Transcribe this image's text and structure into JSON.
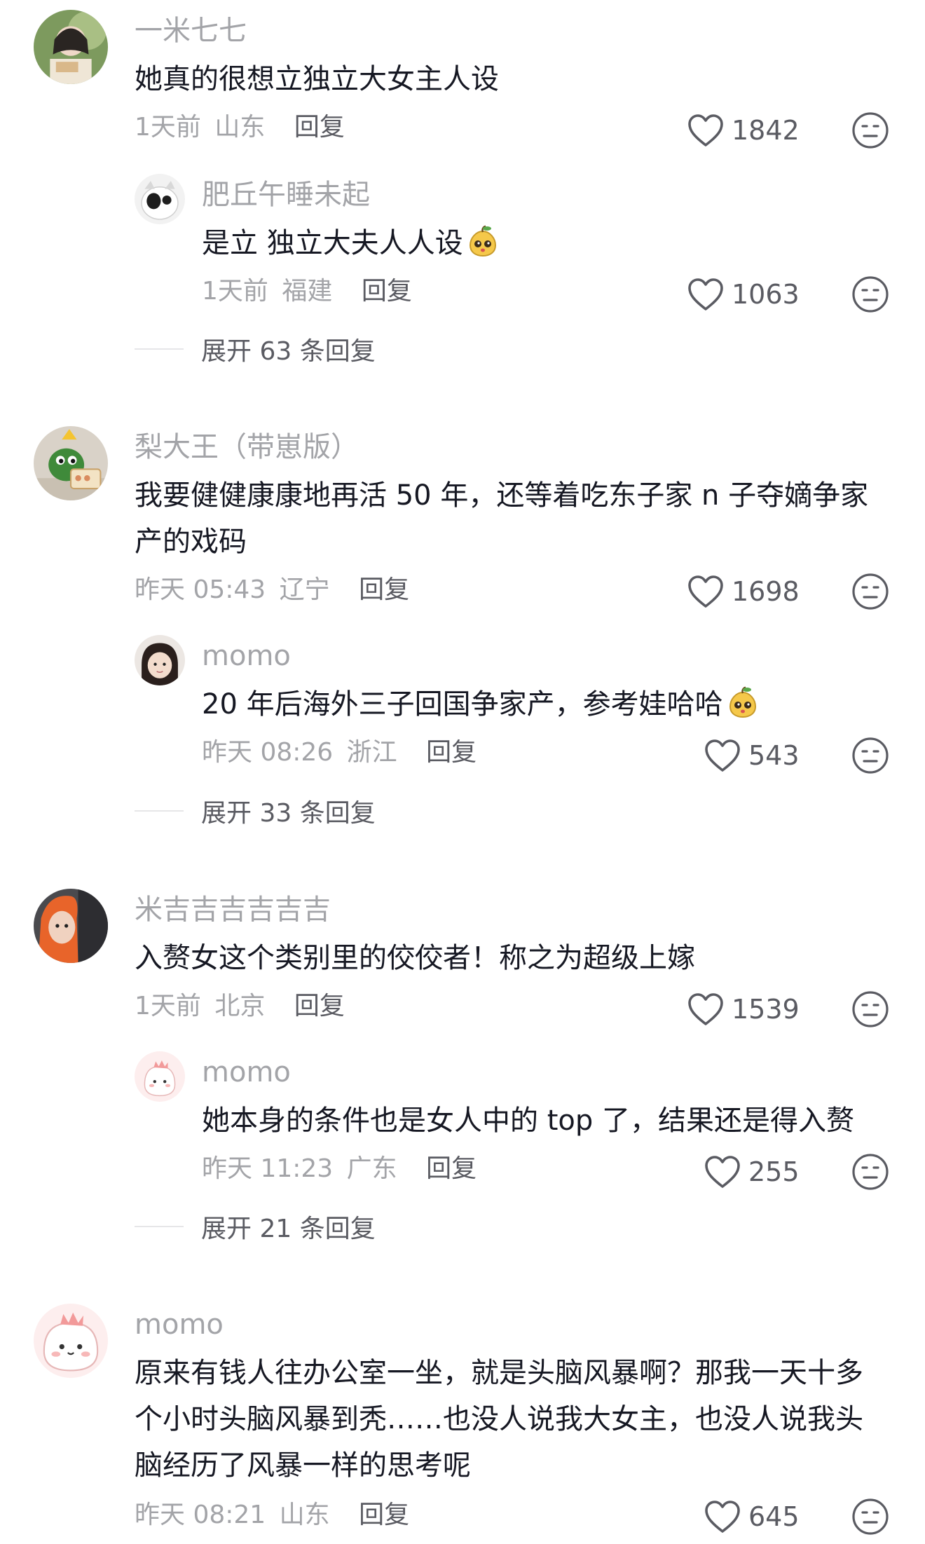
{
  "comments": [
    {
      "user": "一米七七",
      "text": "她真的很想立独立大女主人设",
      "time": "1天前",
      "location": "山东",
      "reply_label": "回复",
      "likes": "1842",
      "replies": [
        {
          "user": "肥丘午睡未起",
          "text": "是立 独立大夫人人设",
          "emoji": "pear-face-emoji",
          "time": "1天前",
          "location": "福建",
          "reply_label": "回复",
          "likes": "1063"
        }
      ],
      "expand_label": "展开 63 条回复"
    },
    {
      "user": "梨大王（带崽版）",
      "text": "我要健健康康地再活 50 年，还等着吃东子家 n 子夺嫡争家产的戏码",
      "time": "昨天 05:43",
      "location": "辽宁",
      "reply_label": "回复",
      "likes": "1698",
      "replies": [
        {
          "user": "momo",
          "text": "20 年后海外三子回国争家产，参考娃哈哈",
          "emoji": "pear-face-emoji",
          "time": "昨天 08:26",
          "location": "浙江",
          "reply_label": "回复",
          "likes": "543"
        }
      ],
      "expand_label": "展开 33 条回复"
    },
    {
      "user": "米吉吉吉吉吉吉",
      "text": "入赘女这个类别里的佼佼者！称之为超级上嫁",
      "time": "1天前",
      "location": "北京",
      "reply_label": "回复",
      "likes": "1539",
      "replies": [
        {
          "user": "momo",
          "text": "她本身的条件也是女人中的 top 了，结果还是得入赘",
          "time": "昨天 11:23",
          "location": "广东",
          "reply_label": "回复",
          "likes": "255"
        }
      ],
      "expand_label": "展开 21 条回复"
    },
    {
      "user": "momo",
      "text": "原来有钱人往办公室一坐，就是头脑风暴啊？那我一天十多个小时头脑风暴到秃……也没人说我大女主，也没人说我头脑经历了风暴一样的思考呢",
      "time": "昨天 08:21",
      "location": "山东",
      "reply_label": "回复",
      "likes": "645"
    }
  ],
  "colors": {
    "text": "#161823",
    "muted": "#a3a4a8",
    "secondary": "#5a5b62"
  }
}
